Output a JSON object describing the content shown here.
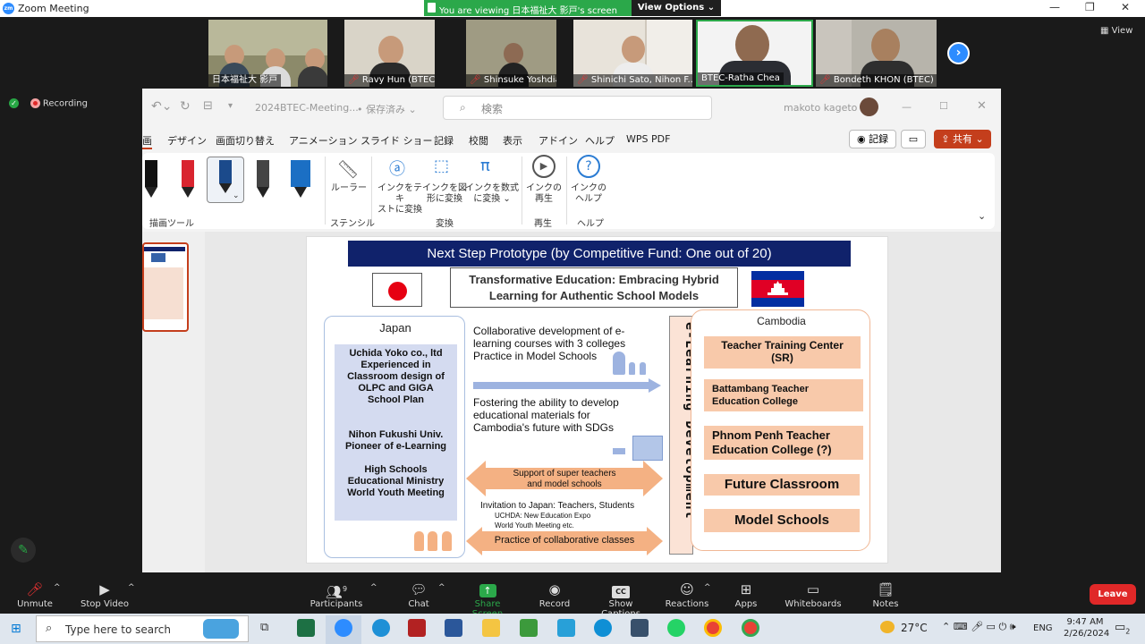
{
  "zoom": {
    "window_title": "Zoom Meeting",
    "viewing_banner": "You are viewing 日本福祉大 影戸's screen",
    "view_options_label": "View Options",
    "view_label": "View",
    "recording_label": "Recording",
    "participants": [
      {
        "name": "日本福祉大  影戸",
        "muted": false
      },
      {
        "name": "Ravy Hun (BTEC)",
        "muted": true
      },
      {
        "name": "Shinsuke Yoshdia",
        "muted": true
      },
      {
        "name": "Shinichi Sato, Nihon F...",
        "muted": true
      },
      {
        "name": "BTEC-Ratha Chea",
        "muted": false
      },
      {
        "name": "Bondeth KHON (BTEC)",
        "muted": true
      }
    ],
    "controls": {
      "unmute": "Unmute",
      "stop_video": "Stop Video",
      "participants": "Participants",
      "participant_count": "9",
      "chat": "Chat",
      "share_screen": "Share Screen",
      "record": "Record",
      "show_captions": "Show Captions",
      "reactions": "Reactions",
      "apps": "Apps",
      "whiteboards": "Whiteboards",
      "notes": "Notes",
      "leave": "Leave"
    }
  },
  "ppt": {
    "file_title": "2024BTEC-Meeting...",
    "save_status": "• 保存済み ⌄",
    "search_placeholder": "検索",
    "user_name": "makoto kageto",
    "menu_tabs": [
      "画",
      "デザイン",
      "画面切り替え",
      "アニメーション",
      "スライド ショー",
      "記録",
      "校閲",
      "表示",
      "アドイン",
      "ヘルプ",
      "WPS PDF"
    ],
    "record_button": "記録",
    "share_button": "共有",
    "ribbon": {
      "ruler": "ルーラー",
      "ink_to_text": [
        "インクをテキ",
        "ストに変換"
      ],
      "ink_to_shape": [
        "インクを図",
        "形に変換"
      ],
      "ink_to_math": [
        "インクを数式",
        "に変換 ⌄"
      ],
      "ink_replay": [
        "インクの",
        "再生"
      ],
      "ink_help": [
        "インクの",
        "ヘルプ"
      ],
      "groups": {
        "drawing_tools": "描画ツール",
        "stencil": "ステンシル",
        "convert": "変換",
        "replay": "再生",
        "help": "ヘルプ"
      }
    }
  },
  "slide": {
    "title": "Next Step Prototype (by Competitive Fund: One out of 20)",
    "heading_line1": "Transformative Education: Embracing Hybrid",
    "heading_line2": "Learning for Authentic School Models",
    "japan_label": "Japan",
    "japan_items": [
      "Uchida Yoko co., ltd",
      "Experienced in",
      "Classroom design  of",
      "OLPC and GIGA",
      "School Plan",
      "Nihon Fukushi Univ.",
      "Pioneer of e-Learning",
      "High Schools",
      "Educational Ministry",
      "World Youth Meeting"
    ],
    "middle": {
      "collab_l1": "Collaborative development of e-",
      "collab_l2": "learning courses with 3 colleges",
      "collab_l3": "Practice in Model Schools",
      "foster_l1": "Fostering the ability to develop",
      "foster_l2": "educational materials for",
      "foster_l3": "Cambodia's future with SDGs",
      "support_l1": "Support of super teachers",
      "support_l2": "and model schools",
      "invite_l1": "Invitation to Japan: Teachers, Students",
      "invite_l2": "UCHDA: New Education Expo",
      "invite_l3": "World Youth Meeting etc.",
      "practice": "Practice of collaborative classes"
    },
    "elearning_label": "e-Learning Development",
    "cambodia_label": "Cambodia",
    "cambodia_items": [
      [
        "Teacher Training Center",
        "(SR)"
      ],
      [
        "Battambang Teacher",
        "Education College"
      ],
      [
        "Phnom Penh Teacher",
        "Education College (?)"
      ],
      [
        "Future Classroom"
      ],
      [
        "Model Schools"
      ]
    ]
  },
  "taskbar": {
    "search_placeholder": "Type here to search",
    "weather": "27°C",
    "language": "ENG",
    "time": "9:47 AM",
    "date": "2/26/2024",
    "notification_count": "2"
  }
}
